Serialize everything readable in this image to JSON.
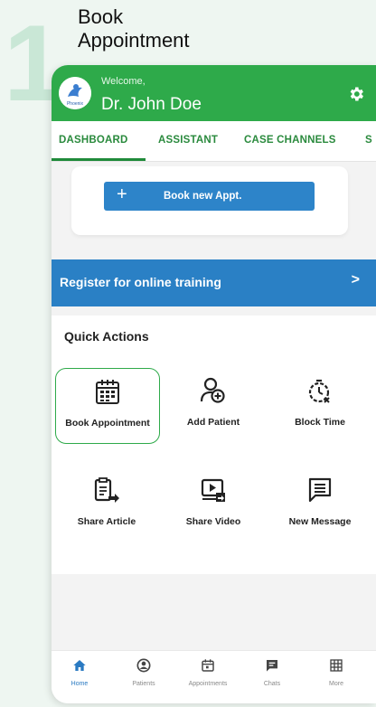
{
  "step": {
    "number": "1",
    "title_line1": "Book",
    "title_line2": "Appointment"
  },
  "header": {
    "welcome": "Welcome,",
    "doctor_name": "Dr. John Doe",
    "logo_text": "Phoenix"
  },
  "tabs": [
    {
      "label": "DASHBOARD",
      "active": true
    },
    {
      "label": "ASSISTANT"
    },
    {
      "label": "CASE CHANNELS"
    },
    {
      "label": "S"
    }
  ],
  "book_card": {
    "button_label": "Book new Appt.",
    "button_plus": "+"
  },
  "register_banner": {
    "label": "Register for online training",
    "chevron": ">"
  },
  "quick_actions": {
    "title": "Quick Actions",
    "items": [
      {
        "label": "Book Appointment",
        "icon": "calendar-grid-icon",
        "selected": true
      },
      {
        "label": "Add Patient",
        "icon": "add-user-icon"
      },
      {
        "label": "Block Time",
        "icon": "timer-block-icon"
      },
      {
        "label": "Share Article",
        "icon": "share-article-icon"
      },
      {
        "label": "Share Video",
        "icon": "share-video-icon"
      },
      {
        "label": "New Message",
        "icon": "message-icon"
      }
    ]
  },
  "bottom_nav": [
    {
      "label": "Home",
      "icon": "home-icon",
      "active": true
    },
    {
      "label": "Patients",
      "icon": "patients-icon"
    },
    {
      "label": "Appointments",
      "icon": "calendar-icon"
    },
    {
      "label": "Chats",
      "icon": "chat-icon"
    },
    {
      "label": "More",
      "icon": "grid-icon"
    }
  ],
  "colors": {
    "brand_green": "#2eaa4a",
    "brand_blue": "#2a80c5",
    "accent_text": "#2a8a3d"
  }
}
